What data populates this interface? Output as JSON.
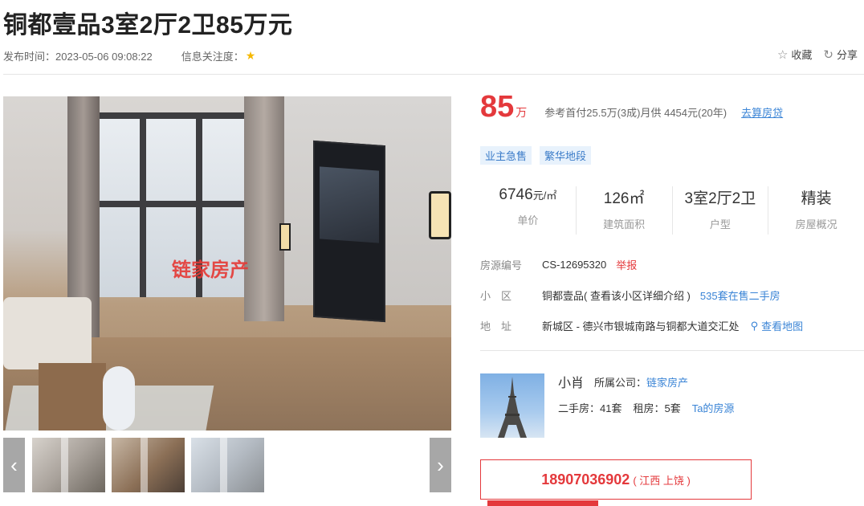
{
  "header": {
    "title": "铜都壹品3室2厅2卫85万元",
    "publish_label": "发布时间：2023-05-06 09:08:22",
    "attention_label": "信息关注度：",
    "favorite_label": "收藏",
    "share_label": "分享"
  },
  "photo": {
    "watermark": "链家房产"
  },
  "price": {
    "amount": "85",
    "unit": "万",
    "reference": "参考首付25.5万(3成)月供 4454元(20年)",
    "loan_link": "去算房贷"
  },
  "tags": [
    "业主急售",
    "繁华地段"
  ],
  "stats": [
    {
      "value": "6746",
      "unit": "元/㎡",
      "label": "单价"
    },
    {
      "value": "126㎡",
      "unit": "",
      "label": "建筑面积"
    },
    {
      "value": "3室2厅2卫",
      "unit": "",
      "label": "户型"
    },
    {
      "value": "精装",
      "unit": "",
      "label": "房屋概况"
    }
  ],
  "listing": {
    "id_label": "房源编号",
    "id_value": "CS-12695320",
    "report": "举报",
    "community_label": "小　区",
    "community_value": "铜都壹品( 查看该小区详细介绍 )",
    "community_link": "535套在售二手房",
    "address_label": "地　址",
    "address_value": "新城区 - 德兴市银城南路与铜都大道交汇处",
    "map_link": "查看地图"
  },
  "agent": {
    "name": "小肖",
    "company_label": "所属公司：",
    "company": "链家房产",
    "second_hand": "二手房：41套",
    "rent": "租房：5套",
    "listings_link": "Ta的房源"
  },
  "contact": {
    "phone": "18907036902",
    "location": "( 江西 上饶 )"
  },
  "icons": {
    "star": "star-icon",
    "favorite": "star-outline-icon",
    "share": "share-icon",
    "map": "map-pin-icon",
    "prev": "chevron-left-icon",
    "next": "chevron-right-icon"
  },
  "colors": {
    "accent": "#e4393c",
    "link": "#3a84d6",
    "tag_bg": "#e8f2fc"
  }
}
